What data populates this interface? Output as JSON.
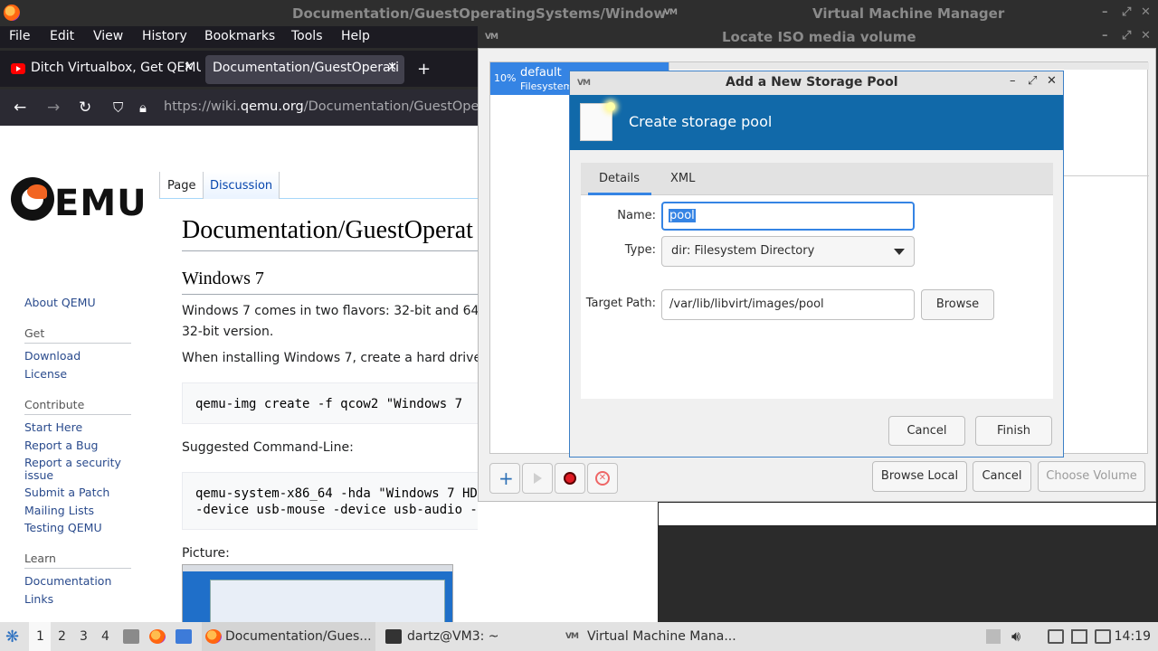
{
  "firefox": {
    "window_title": "Documentation/GuestOperatingSystems/Window",
    "menu": [
      "File",
      "Edit",
      "View",
      "History",
      "Bookmarks",
      "Tools",
      "Help"
    ],
    "tabs": [
      {
        "label": "Ditch Virtualbox, Get QEMU"
      },
      {
        "label": "Documentation/GuestOperati"
      }
    ],
    "new_tab": "+",
    "url_prefix": "https://wiki.",
    "url_domain": "qemu.org",
    "url_path": "/Documentation/GuestOpera"
  },
  "wiki": {
    "logo_text": "EMU",
    "sidebar": {
      "about": "About QEMU",
      "get_head": "Get",
      "download": "Download",
      "license": "License",
      "contribute_head": "Contribute",
      "start_here": "Start Here",
      "report_bug": "Report a Bug",
      "report_security_1": "Report a security",
      "report_security_2": "issue",
      "submit_patch": "Submit a Patch",
      "mailing_lists": "Mailing Lists",
      "testing": "Testing QEMU",
      "learn_head": "Learn",
      "documentation": "Documentation",
      "links": "Links"
    },
    "tab_page": "Page",
    "tab_discussion": "Discussion",
    "title": "Documentation/GuestOperat",
    "h2": "Windows 7",
    "p1_line1": "Windows 7 comes in two flavors: 32-bit and 64",
    "p1_line2": "32-bit version.",
    "p2": "When installing Windows 7, create a hard drive",
    "code1": "qemu-img create -f qcow2 \"Windows 7",
    "suggested": "Suggested Command-Line:",
    "code2_line1": "qemu-system-x86_64 -hda \"Windows 7 HD",
    "code2_line2": "-device usb-mouse -device usb-audio -localtime -boot c -netde",
    "picture": "Picture:"
  },
  "vmm": {
    "window_title": "Virtual Machine Manager"
  },
  "locate": {
    "title": "Locate ISO media volume",
    "pool_pct": "10%",
    "pool_name": "default",
    "pool_sub": "Filesystem",
    "browse_local": "Browse Local",
    "cancel": "Cancel",
    "choose_volume": "Choose Volume"
  },
  "pool_dialog": {
    "title": "Add a New Storage Pool",
    "banner": "Create storage pool",
    "tab_details": "Details",
    "tab_xml": "XML",
    "name_label": "Name:",
    "name_value": "pool",
    "type_label": "Type:",
    "type_value": "dir: Filesystem Directory",
    "target_label": "Target Path:",
    "target_value": "/var/lib/libvirt/images/pool",
    "browse": "Browse",
    "cancel": "Cancel",
    "finish": "Finish"
  },
  "taskbar": {
    "workspaces": [
      "1",
      "2",
      "3",
      "4"
    ],
    "items": [
      {
        "label": "Documentation/Gues..."
      },
      {
        "label": "dartz@VM3: ~"
      },
      {
        "label": "Virtual Machine Mana..."
      }
    ],
    "clock": "14:19"
  }
}
